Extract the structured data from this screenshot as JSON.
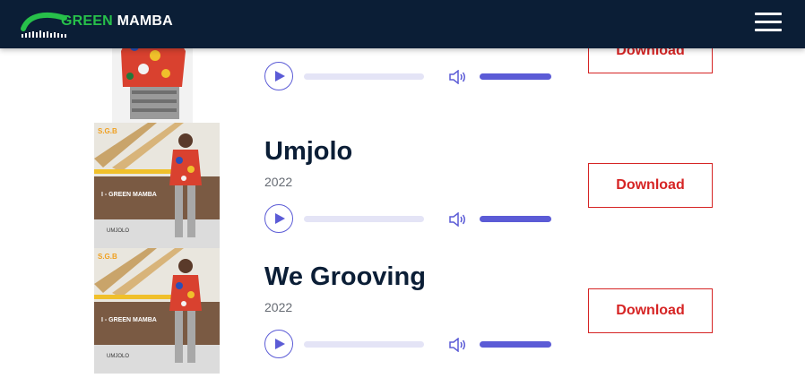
{
  "header": {
    "logo_green": "GREEN",
    "logo_white": "MAMBA",
    "menu_icon": "hamburger-menu-icon"
  },
  "colors": {
    "navbar": "#0b1e36",
    "accent": "#5b5bd6",
    "download": "#d62424",
    "title": "#0b1e36"
  },
  "cover_art": {
    "artist": "I - GREEN MAMBA",
    "tag": "S.G.B"
  },
  "tracks": [
    {
      "title": "",
      "year": "",
      "download_label": "Download",
      "progress": 0,
      "volume": 1.0
    },
    {
      "title": "Umjolo",
      "year": "2022",
      "download_label": "Download",
      "progress": 0,
      "volume": 1.0,
      "cover_caption": "UMJOLO"
    },
    {
      "title": "We Grooving",
      "year": "2022",
      "download_label": "Download",
      "progress": 0,
      "volume": 1.0,
      "cover_caption": "UMJOLO"
    }
  ]
}
